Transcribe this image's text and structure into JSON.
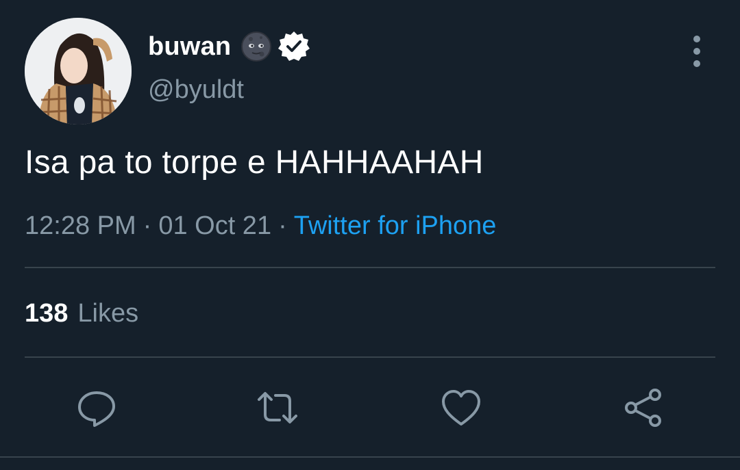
{
  "user": {
    "display_name": "buwan",
    "name_emoji": "new-moon-face-emoji",
    "verified": true,
    "handle": "@byuldt",
    "avatar": "avatar-photo"
  },
  "tweet": {
    "text": "Isa pa to torpe e HAHHAAHAH",
    "time": "12:28 PM",
    "separator": "·",
    "date": "01 Oct 21",
    "source": "Twitter for iPhone"
  },
  "stats": {
    "likes_count": "138",
    "likes_label": "Likes"
  },
  "actions": [
    {
      "icon": "reply-icon"
    },
    {
      "icon": "retweet-icon"
    },
    {
      "icon": "like-icon"
    },
    {
      "icon": "share-icon"
    }
  ],
  "colors": {
    "background": "#15202b",
    "primary_text": "#ffffff",
    "secondary_text": "#8899a6",
    "accent": "#1da1f2",
    "divider": "#38444d"
  }
}
